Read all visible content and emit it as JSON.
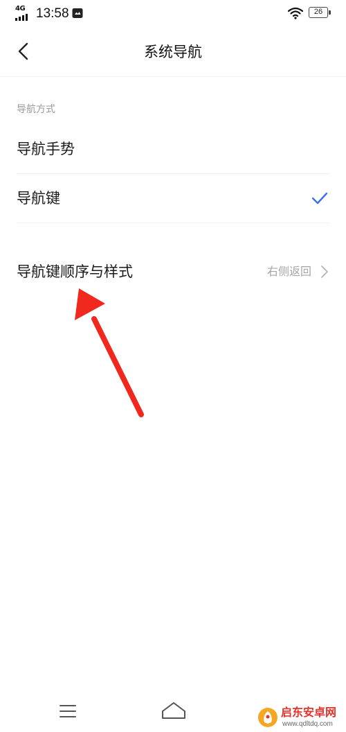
{
  "status_bar": {
    "network": "4G",
    "time": "13:58",
    "battery": "26",
    "icons": [
      "signal-icon",
      "message-icon",
      "wifi-icon",
      "battery-icon"
    ]
  },
  "header": {
    "title": "系统导航",
    "back_icon": "chevron-left-icon"
  },
  "section": {
    "label": "导航方式"
  },
  "options": [
    {
      "label": "导航手势",
      "selected": false
    },
    {
      "label": "导航键",
      "selected": true
    }
  ],
  "order_row": {
    "label": "导航键顺序与样式",
    "value": "右侧返回",
    "icon": "chevron-right-icon"
  },
  "nav_bar": {
    "icons": [
      "menu-icon",
      "home-icon"
    ]
  },
  "watermark": {
    "text": "启东安卓网",
    "url": "www.qdltdq.com"
  },
  "colors": {
    "accent": "#3a6fe8",
    "annotation": "#f0281e",
    "secondary_text": "#9a9a9a"
  }
}
